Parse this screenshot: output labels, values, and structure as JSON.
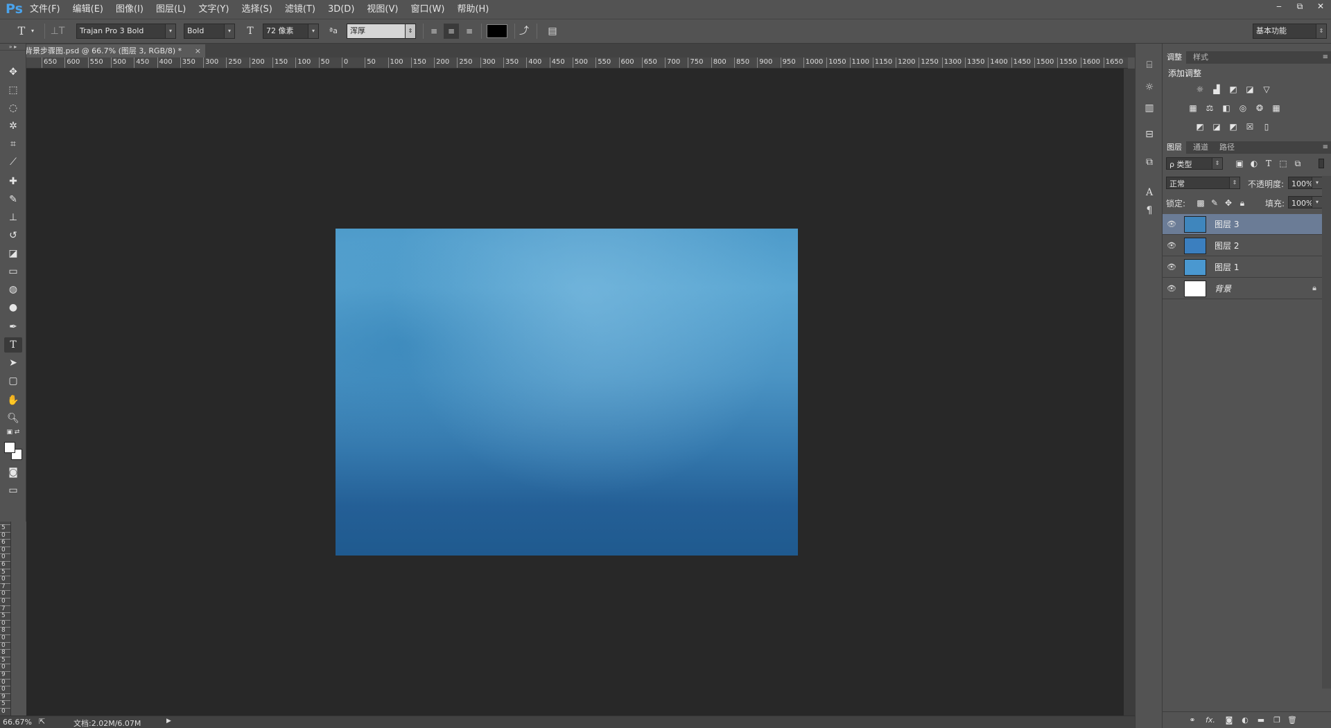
{
  "app": {
    "logo": "Ps"
  },
  "menu": [
    "文件(F)",
    "编辑(E)",
    "图像(I)",
    "图层(L)",
    "文字(Y)",
    "选择(S)",
    "滤镜(T)",
    "3D(D)",
    "视图(V)",
    "窗口(W)",
    "帮助(H)"
  ],
  "window_controls": {
    "minimize": "‒",
    "restore": "⧉",
    "close": "✕"
  },
  "options": {
    "font_family": "Trajan Pro 3 Bold",
    "font_style": "Bold",
    "font_size": "72 像素",
    "aa_label": "ªa",
    "antialias": "浑厚",
    "text_color": "#000000",
    "workspace": "基本功能"
  },
  "document": {
    "tab_title": "背景步骤图.psd @ 66.7% (图层 3, RGB/8) *",
    "tab_close": "×"
  },
  "ruler": {
    "h_labels": [
      "650",
      "600",
      "550",
      "500",
      "450",
      "400",
      "350",
      "300",
      "250",
      "200",
      "150",
      "100",
      "50",
      "0",
      "50",
      "100",
      "150",
      "200",
      "250",
      "300",
      "350",
      "400",
      "450",
      "500",
      "550",
      "600",
      "650",
      "700",
      "750",
      "800",
      "850",
      "900",
      "950",
      "1000",
      "1050",
      "1100",
      "1150",
      "1200",
      "1250",
      "1300",
      "1350",
      "1400",
      "1450",
      "1500",
      "1550",
      "1600",
      "1650"
    ],
    "v_labels": [
      "5",
      "0",
      "6",
      "0",
      "0",
      "6",
      "5",
      "0",
      "7",
      "0",
      "0",
      "7",
      "5",
      "0",
      "8",
      "0",
      "0",
      "8",
      "5",
      "0",
      "9",
      "0",
      "0",
      "9",
      "5",
      "0"
    ]
  },
  "status": {
    "zoom": "66.67%",
    "doc_info": "文档:2.02M/6.07M"
  },
  "panels": {
    "adjust_tabs": [
      "调整",
      "样式"
    ],
    "adjust_title": "添加调整",
    "layers_tabs": [
      "图层",
      "通道",
      "路径"
    ],
    "filter_kind": "ρ 类型",
    "blend_mode": "正常",
    "opacity_label": "不透明度:",
    "opacity_value": "100%",
    "lock_label": "锁定:",
    "fill_label": "填充:",
    "fill_value": "100%",
    "layers": [
      {
        "name": "图层 3",
        "selected": true,
        "thumb": "#3f86bd"
      },
      {
        "name": "图层 2",
        "selected": false,
        "thumb": "#3b7fbf"
      },
      {
        "name": "图层 1",
        "selected": false,
        "thumb": "#4a98d0"
      },
      {
        "name": "背景",
        "selected": false,
        "thumb": "#ffffff",
        "locked": true
      }
    ]
  },
  "colors": {
    "accent": "#4aa3ec",
    "selected_layer": "#6b7c96",
    "canvas_bg": "#282828"
  }
}
